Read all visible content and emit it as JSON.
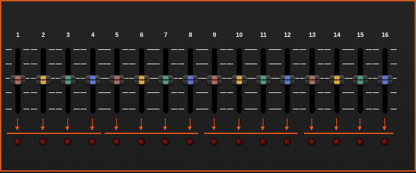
{
  "channels": [
    {
      "label": "1",
      "color": "#b06a62"
    },
    {
      "label": "2",
      "color": "#e0a43c"
    },
    {
      "label": "3",
      "color": "#4f9e7a"
    },
    {
      "label": "4",
      "color": "#5b78d8"
    },
    {
      "label": "5",
      "color": "#b06a62"
    },
    {
      "label": "6",
      "color": "#e0a43c"
    },
    {
      "label": "7",
      "color": "#4f9e7a"
    },
    {
      "label": "8",
      "color": "#5b78d8"
    },
    {
      "label": "9",
      "color": "#b06a62"
    },
    {
      "label": "10",
      "color": "#e0a43c"
    },
    {
      "label": "11",
      "color": "#4f9e7a"
    },
    {
      "label": "12",
      "color": "#5b78d8"
    },
    {
      "label": "13",
      "color": "#b06a62"
    },
    {
      "label": "14",
      "color": "#e0a43c"
    },
    {
      "label": "15",
      "color": "#4f9e7a"
    },
    {
      "label": "16",
      "color": "#5b78d8"
    }
  ],
  "theme": {
    "accent": "#d9541c",
    "frame": "#d2581f",
    "background": "#1f1f1f"
  }
}
